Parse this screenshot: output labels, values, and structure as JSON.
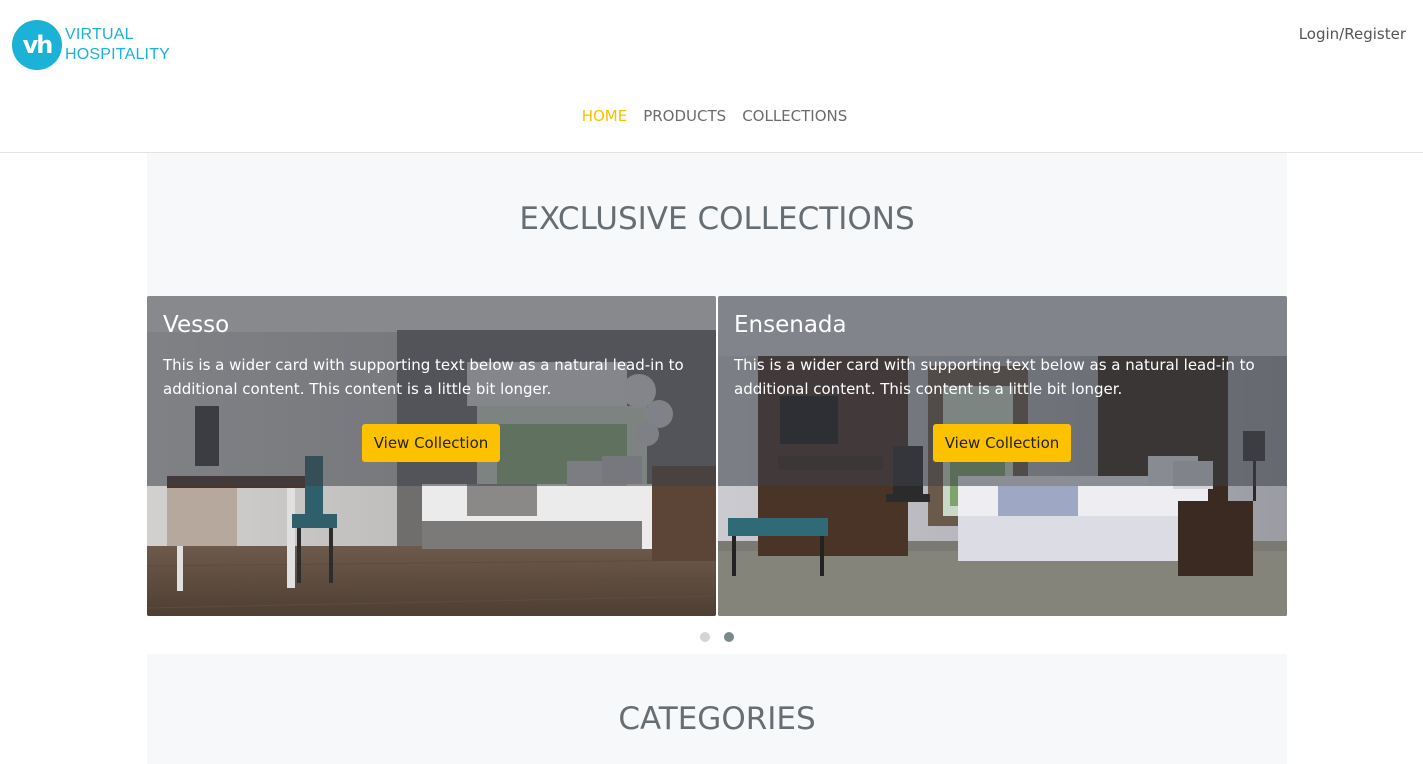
{
  "brand": {
    "logo_mark": "vh",
    "name_line1": "VIRTUAL",
    "name_line2": "HOSPITALITY",
    "color": "#1ab2d6"
  },
  "header": {
    "login_label": "Login/Register"
  },
  "nav": {
    "items": [
      {
        "label": "HOME",
        "active": true
      },
      {
        "label": "PRODUCTS",
        "active": false
      },
      {
        "label": "COLLECTIONS",
        "active": false
      }
    ],
    "active_color": "#f5c000"
  },
  "collections": {
    "title": "EXCLUSIVE COLLECTIONS",
    "cards": [
      {
        "title": "Vesso",
        "text": "This is a wider card with supporting text below as a natural lead-in to additional content. This content is a little bit longer.",
        "button_label": "View Collection"
      },
      {
        "title": "Ensenada",
        "text": "This is a wider card with supporting text below as a natural lead-in to additional content. This content is a little bit longer.",
        "button_label": "View Collection"
      }
    ],
    "carousel": {
      "pages": 2,
      "active_page": 2
    }
  },
  "categories": {
    "title": "CATEGORIES"
  },
  "colors": {
    "button": "#fcc200",
    "section_bg": "#f7f8f9",
    "title": "#666e74"
  }
}
